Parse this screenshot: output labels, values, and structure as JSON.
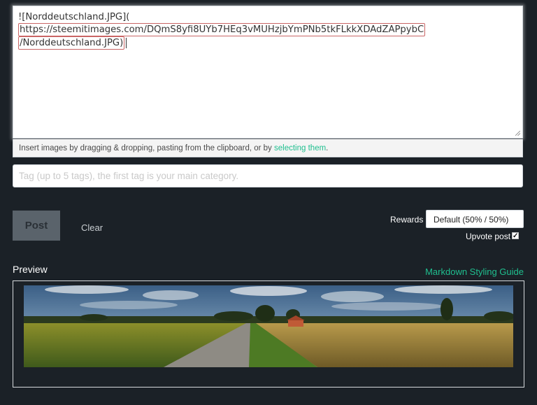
{
  "editor": {
    "prefix": "![Norddeutschland.JPG](",
    "url_line1": "https://steemitimages.com/DQmS8yfi8UYb7HEq3vMUHzjbYmPNb5tkFLkkXDAdZAPpybC",
    "url_line2": "/Norddeutschland.JPG)"
  },
  "upload_hint": {
    "text": "Insert images by dragging & dropping, pasting from the clipboard, or by ",
    "link": "selecting them",
    "suffix": "."
  },
  "tags": {
    "placeholder": "Tag (up to 5 tags), the first tag is your main category."
  },
  "actions": {
    "post_label": "Post",
    "clear_label": "Clear"
  },
  "rewards": {
    "label": "Rewards",
    "selected": "Default (50% / 50%)",
    "upvote_label": "Upvote post",
    "upvote_checked": true
  },
  "preview": {
    "title": "Preview",
    "guide_link": "Markdown Styling Guide"
  },
  "colors": {
    "background": "#1b2127",
    "accent": "#1fbf8f",
    "post_button": "#5a636b"
  }
}
